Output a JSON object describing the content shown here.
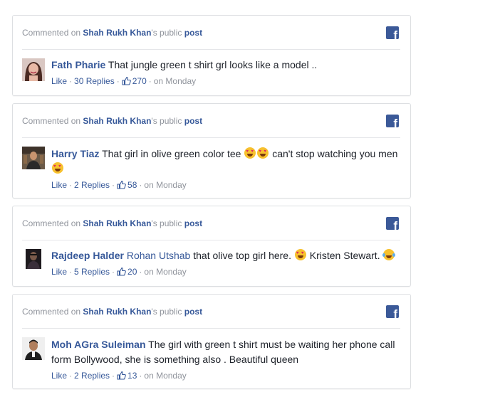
{
  "colors": {
    "link": "#365899",
    "muted": "#90949c",
    "fb_blue": "#3b5998",
    "border": "#dddfe2"
  },
  "header": {
    "prefix": "Commented on",
    "page_name": "Shah Rukh Khan",
    "possessive": "'s public",
    "post_link": "post",
    "icon": "facebook-icon"
  },
  "comments": [
    {
      "author": "Fath Pharie",
      "text_1": "That jungle green t shirt grl looks like a model ..",
      "like": "Like",
      "replies": "30 Replies",
      "likes": "270",
      "time": "on Monday"
    },
    {
      "author": "Harry Tiaz",
      "text_1": "That girl in olive green color tee",
      "text_2": "can't stop watching you men",
      "like": "Like",
      "replies": "2 Replies",
      "likes": "58",
      "time": "on Monday"
    },
    {
      "author": "Rajdeep Halder",
      "mention": "Rohan Utshab",
      "text_1": "that olive top girl here.",
      "text_2": "Kristen Stewart.",
      "like": "Like",
      "replies": "5 Replies",
      "likes": "20",
      "time": "on Monday"
    },
    {
      "author": "Moh AGra Suleiman",
      "text_1": "The girl with green t shirt must be waiting her phone call form Bollywood, she is something also . Beautiful queen",
      "like": "Like",
      "replies": "2 Replies",
      "likes": "13",
      "time": "on Monday"
    }
  ]
}
